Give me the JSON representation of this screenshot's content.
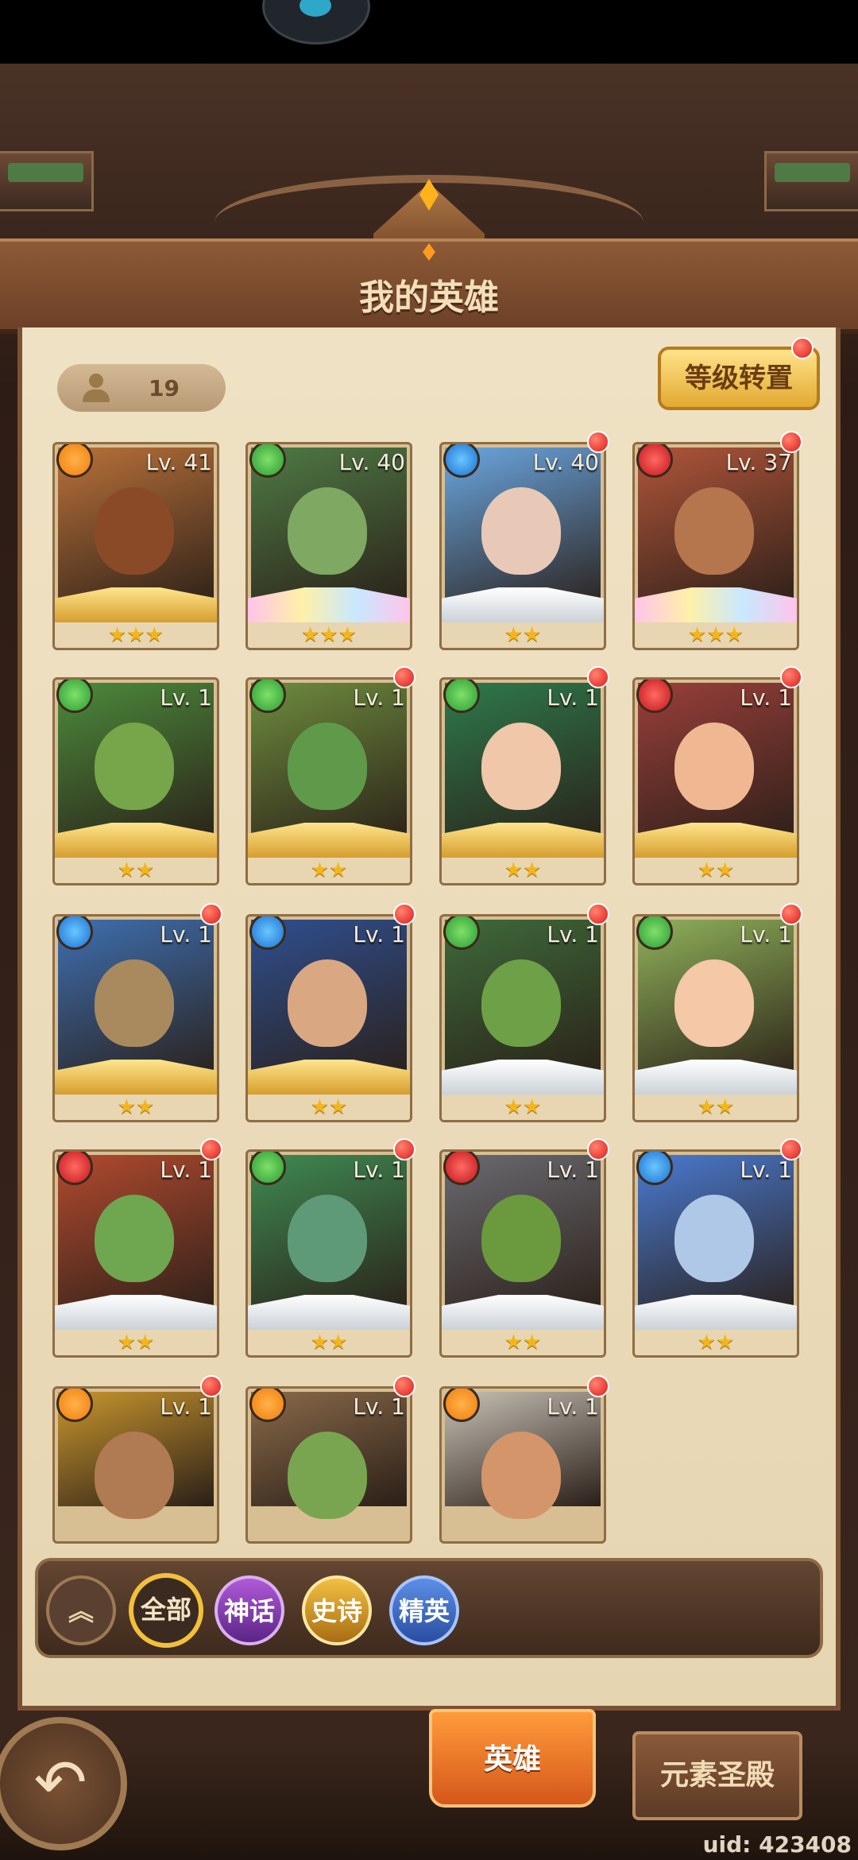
{
  "title": "我的英雄",
  "hero_count": "19",
  "level_transfer_button": "等级转置",
  "heroes": [
    {
      "level": "Lv. 41",
      "element": "fire",
      "frame": "gold",
      "stars": "★★★",
      "new": false,
      "art": "#b9713a",
      "skin": "#8a4a28"
    },
    {
      "level": "Lv. 40",
      "element": "nature",
      "frame": "rainbow",
      "stars": "★★★",
      "new": false,
      "art": "#4f7a45",
      "skin": "#7fa862"
    },
    {
      "level": "Lv. 40",
      "element": "water",
      "frame": "silver",
      "stars": "★★",
      "new": true,
      "art": "#6aa6e0",
      "skin": "#e8c9b8"
    },
    {
      "level": "Lv. 37",
      "element": "blood",
      "frame": "rainbow",
      "stars": "★★★",
      "new": true,
      "art": "#b0553a",
      "skin": "#b5764e"
    },
    {
      "level": "Lv. 1",
      "element": "nature",
      "frame": "gold",
      "stars": "★★",
      "new": false,
      "art": "#4c8a3c",
      "skin": "#76a54a"
    },
    {
      "level": "Lv. 1",
      "element": "nature",
      "frame": "gold",
      "stars": "★★",
      "new": true,
      "art": "#6e8c3e",
      "skin": "#5f9a4a"
    },
    {
      "level": "Lv. 1",
      "element": "nature",
      "frame": "gold",
      "stars": "★★",
      "new": true,
      "art": "#2e7a4c",
      "skin": "#f0c7a8"
    },
    {
      "level": "Lv. 1",
      "element": "blood",
      "frame": "gold",
      "stars": "★★",
      "new": true,
      "art": "#9a3f3a",
      "skin": "#f0b892"
    },
    {
      "level": "Lv. 1",
      "element": "water",
      "frame": "gold",
      "stars": "★★",
      "new": true,
      "art": "#3e6fb0",
      "skin": "#a88a5e"
    },
    {
      "level": "Lv. 1",
      "element": "water",
      "frame": "gold",
      "stars": "★★",
      "new": true,
      "art": "#2f4f8f",
      "skin": "#d9a883"
    },
    {
      "level": "Lv. 1",
      "element": "nature",
      "frame": "silver",
      "stars": "★★",
      "new": true,
      "art": "#3e6a3a",
      "skin": "#6ea048"
    },
    {
      "level": "Lv. 1",
      "element": "nature",
      "frame": "silver",
      "stars": "★★",
      "new": true,
      "art": "#8fb15a",
      "skin": "#f5c8a8"
    },
    {
      "level": "Lv. 1",
      "element": "blood",
      "frame": "silver",
      "stars": "★★",
      "new": true,
      "art": "#b14a2f",
      "skin": "#6fa650"
    },
    {
      "level": "Lv. 1",
      "element": "nature",
      "frame": "silver",
      "stars": "★★",
      "new": true,
      "art": "#3f8a52",
      "skin": "#5f9a78"
    },
    {
      "level": "Lv. 1",
      "element": "blood",
      "frame": "silver",
      "stars": "★★",
      "new": true,
      "art": "#6a6a70",
      "skin": "#6b9a3e"
    },
    {
      "level": "Lv. 1",
      "element": "water",
      "frame": "silver",
      "stars": "★★",
      "new": true,
      "art": "#4a7ad0",
      "skin": "#b0c8e8"
    },
    {
      "level": "Lv. 1",
      "element": "fire",
      "frame": "gold",
      "stars": "",
      "new": true,
      "art": "#c9962e",
      "skin": "#b07a52"
    },
    {
      "level": "Lv. 1",
      "element": "fire",
      "frame": "gold",
      "stars": "",
      "new": true,
      "art": "#8a6a4a",
      "skin": "#7aa550"
    },
    {
      "level": "Lv. 1",
      "element": "fire",
      "frame": "silver",
      "stars": "",
      "new": true,
      "art": "#c7c1b5",
      "skin": "#d4956a"
    }
  ],
  "filters": {
    "collapse_icon": "double-chevron-up-icon",
    "all": "全部",
    "mythic": "神话",
    "epic": "史诗",
    "elite": "精英"
  },
  "tabs": {
    "heroes": "英雄",
    "element_temple": "元素圣殿"
  },
  "back_icon": "back-arrow-icon",
  "uid": "uid: 423408"
}
